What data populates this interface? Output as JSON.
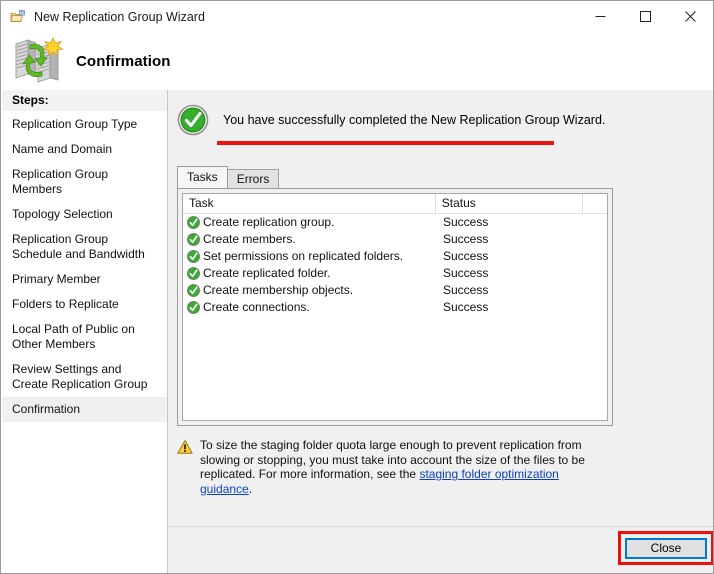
{
  "window": {
    "title": "New Replication Group Wizard",
    "title_icon": "replication-folder-icon",
    "minimize_label": "—",
    "maximize_label": "☐",
    "close_label": "✕"
  },
  "header": {
    "title": "Confirmation",
    "icon": "replication-servers-icon"
  },
  "sidebar": {
    "heading": "Steps:",
    "items": [
      {
        "label": "Replication Group Type",
        "current": false
      },
      {
        "label": "Name and Domain",
        "current": false
      },
      {
        "label": "Replication Group Members",
        "current": false
      },
      {
        "label": "Topology Selection",
        "current": false
      },
      {
        "label": "Replication Group Schedule and Bandwidth",
        "current": false
      },
      {
        "label": "Primary Member",
        "current": false
      },
      {
        "label": "Folders to Replicate",
        "current": false
      },
      {
        "label": "Local Path of Public on Other Members",
        "current": false
      },
      {
        "label": "Review Settings and Create Replication Group",
        "current": false
      },
      {
        "label": "Confirmation",
        "current": true
      }
    ]
  },
  "content": {
    "success_message": "You have successfully completed the New Replication Group Wizard.",
    "success_icon": "green-check-circle-icon",
    "highlight_color": "#ee1111",
    "tabs": [
      {
        "label": "Tasks",
        "active": true
      },
      {
        "label": "Errors",
        "active": false
      }
    ],
    "table": {
      "columns": [
        "Task",
        "Status",
        ""
      ],
      "rows": [
        {
          "icon": "green-check-icon",
          "task": "Create replication group.",
          "status": "Success"
        },
        {
          "icon": "green-check-icon",
          "task": "Create members.",
          "status": "Success"
        },
        {
          "icon": "green-check-icon",
          "task": "Set permissions on replicated folders.",
          "status": "Success"
        },
        {
          "icon": "green-check-icon",
          "task": "Create replicated folder.",
          "status": "Success"
        },
        {
          "icon": "green-check-icon",
          "task": "Create membership objects.",
          "status": "Success"
        },
        {
          "icon": "green-check-icon",
          "task": "Create connections.",
          "status": "Success"
        }
      ]
    },
    "note": {
      "icon": "warning-triangle-icon",
      "text_before": "To size the staging folder quota large enough to prevent replication from slowing or stopping, you must take into account the size of the files to be replicated. For more information, see the ",
      "link_text": "staging folder optimization guidance",
      "text_after": ".",
      "link_color": "#0b41c9"
    }
  },
  "footer": {
    "close_label": "Close",
    "close_highlight_color": "#ee1111",
    "close_focus_color": "#0078d7"
  }
}
